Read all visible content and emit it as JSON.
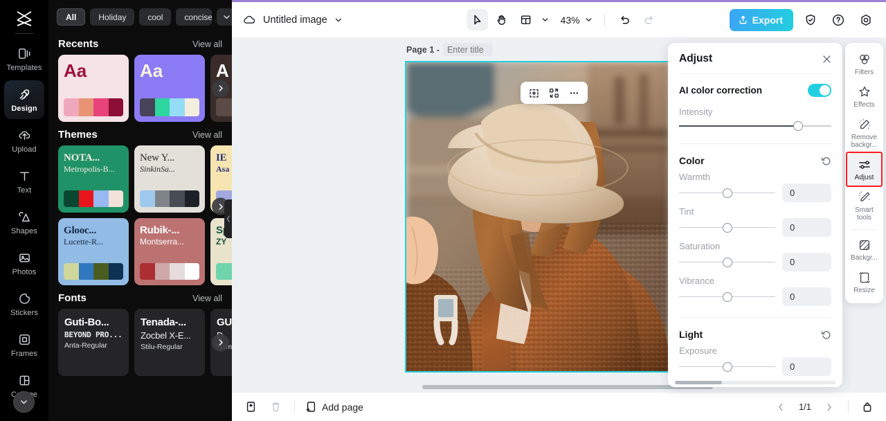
{
  "app": {
    "brand_icon": "capcut-logo-icon",
    "accent_top": "#9b7fd4"
  },
  "rail": {
    "items": [
      {
        "label": "Templates",
        "icon": "templates-icon",
        "active": false
      },
      {
        "label": "Design",
        "icon": "design-brush-icon",
        "active": true
      },
      {
        "label": "Upload",
        "icon": "upload-cloud-icon",
        "active": false
      },
      {
        "label": "Text",
        "icon": "text-t-icon",
        "active": false
      },
      {
        "label": "Shapes",
        "icon": "shapes-icon",
        "active": false
      },
      {
        "label": "Photos",
        "icon": "photos-image-icon",
        "active": false
      },
      {
        "label": "Stickers",
        "icon": "stickers-icon",
        "active": false
      },
      {
        "label": "Frames",
        "icon": "frames-icon",
        "active": false
      },
      {
        "label": "Collage",
        "icon": "collage-icon",
        "active": false
      }
    ],
    "collapse_icon": "chevron-down-icon"
  },
  "panel": {
    "chips": [
      {
        "label": "All",
        "selected": true
      },
      {
        "label": "Holiday",
        "selected": false
      },
      {
        "label": "cool",
        "selected": false
      },
      {
        "label": "concise",
        "selected": false
      }
    ],
    "chips_more_icon": "chevron-down-icon",
    "sections": [
      {
        "title": "Recents",
        "view_all": "View all"
      },
      {
        "title": "Themes",
        "view_all": "View all"
      },
      {
        "title": "Fonts",
        "view_all": "View all"
      }
    ],
    "recents": [
      {
        "sample": "Aa",
        "bg": "#f6e3e6",
        "fg": "#9e123c",
        "swatches": [
          "#f0a8bd",
          "#e79374",
          "#e8437b",
          "#8c0e35"
        ]
      },
      {
        "sample": "Aa",
        "bg": "#8b7bf5",
        "fg": "#f6f2dd",
        "swatches": [
          "#474359",
          "#2ed6a0",
          "#95dcf7",
          "#f3eedd"
        ]
      },
      {
        "sample": "A",
        "bg": "#3a2c2a",
        "fg": "#ffffff",
        "swatches": [
          "#5b4a46",
          "#3a2c2a",
          "#5b4a46",
          "#3a2c2a"
        ]
      }
    ],
    "themes": [
      {
        "line1": "NOTA...",
        "line2": "Metropolis-B...",
        "bg": "#1f9367",
        "fg": "#f7ece3",
        "swatches": [
          "#0a4733",
          "#e8161c",
          "#97b8f0",
          "#f2e2d9"
        ]
      },
      {
        "line1": "New Y...",
        "line2": "SinkinSa...",
        "bg": "#e3e0da",
        "fg": "#2a2a2c",
        "swatches": [
          "#9fc8ed",
          "#7f8489",
          "#474d54",
          "#1d2127"
        ]
      },
      {
        "line1": "IE",
        "line2": "Asa",
        "bg": "#f6e5b0",
        "fg": "#27307e",
        "swatches": [
          "#a3a9e0",
          "#a3a9e0",
          "#a3a9e0",
          "#a3a9e0"
        ]
      },
      {
        "line1": "Glooc...",
        "line2": "Lucette-R...",
        "bg": "#92bbe6",
        "fg": "#152a45",
        "swatches": [
          "#cfd79a",
          "#2f78c0",
          "#4b5c21",
          "#0d3253"
        ]
      },
      {
        "line1": "Rubik-...",
        "line2": "Montserra...",
        "bg": "#bd7272",
        "fg": "#ffffff",
        "swatches": [
          "#ab2f33",
          "#cfa9a9",
          "#e6dcdb",
          "#ffffff"
        ]
      },
      {
        "line1": "Sp",
        "line2": "ZY",
        "bg": "#e8e3cb",
        "fg": "#13533f",
        "swatches": [
          "#6fd4ab",
          "#6fd4ab",
          "#6fd4ab",
          "#6fd4ab"
        ]
      }
    ],
    "fonts": [
      {
        "l1": "Guti-Bo...",
        "l2": "BEYOND PRO...",
        "l3": "Anta-Regular"
      },
      {
        "l1": "Tenada-...",
        "l2": "Zocbel X-E...",
        "l3": "Stilu-Regular"
      },
      {
        "l1": "GU",
        "l2": "D",
        "l3": "Ham"
      }
    ],
    "next_arrow_icon": "chevron-right-icon",
    "collapse_handle_icon": "chevron-left-icon"
  },
  "topbar": {
    "cloud_icon": "cloud-saved-icon",
    "doc_title": "Untitled image",
    "doc_title_chevron": "chevron-down-icon",
    "tools": [
      {
        "name": "select-tool",
        "icon": "cursor-arrow-icon",
        "active": true
      },
      {
        "name": "hand-tool",
        "icon": "hand-icon",
        "active": false
      },
      {
        "name": "layout-tool",
        "icon": "layout-panel-icon",
        "active": false
      }
    ],
    "layout_chevron": "chevron-down-icon",
    "zoom_level": "43%",
    "zoom_chevron": "chevron-down-icon",
    "undo_icon": "undo-arrow-icon",
    "redo_icon": "redo-arrow-icon",
    "export_label": "Export",
    "export_icon": "upload-share-icon",
    "shield_icon": "shield-check-icon",
    "help_icon": "question-circle-icon",
    "settings_icon": "gear-icon"
  },
  "canvas": {
    "page_label": "Page 1 -",
    "title_placeholder": "Enter title",
    "title_value": "",
    "float_tools": [
      {
        "name": "crop-icon"
      },
      {
        "name": "replace-image-icon"
      },
      {
        "name": "more-options-icon"
      }
    ],
    "selection_color": "#22cfe0",
    "image_alt": "Woman in cream wide-brim hat and brown teddy coat, golden-hour portrait"
  },
  "adjust": {
    "title": "Adjust",
    "close_icon": "close-x-icon",
    "ai_color_correction": {
      "label": "AI color correction",
      "enabled": true
    },
    "intensity": {
      "label": "Intensity",
      "percent": 78
    },
    "sections": [
      {
        "title": "Color",
        "reset_icon": "reset-circular-icon",
        "controls": [
          {
            "label": "Warmth",
            "value": "0",
            "percent": 50
          },
          {
            "label": "Tint",
            "value": "0",
            "percent": 50
          },
          {
            "label": "Saturation",
            "value": "0",
            "percent": 50
          },
          {
            "label": "Vibrance",
            "value": "0",
            "percent": 50
          }
        ]
      },
      {
        "title": "Light",
        "reset_icon": "reset-circular-icon",
        "controls": [
          {
            "label": "Exposure",
            "value": "0",
            "percent": 50
          }
        ]
      }
    ]
  },
  "right_rail": {
    "items": [
      {
        "label": "Filters",
        "icon": "filters-circles-icon",
        "selected": false,
        "highlighted": false
      },
      {
        "label": "Effects",
        "icon": "effects-sparkle-icon",
        "selected": false,
        "highlighted": false
      },
      {
        "label": "Remove backgr...",
        "icon": "remove-background-icon",
        "selected": false,
        "highlighted": false
      },
      {
        "label": "Adjust",
        "icon": "adjust-sliders-icon",
        "selected": true,
        "highlighted": true
      },
      {
        "label": "Smart tools",
        "icon": "smart-tools-wand-icon",
        "selected": false,
        "highlighted": false
      },
      {
        "label": "Backgr...",
        "icon": "background-icon",
        "selected": false,
        "highlighted": false
      },
      {
        "label": "Resize",
        "icon": "resize-icon",
        "selected": false,
        "highlighted": false
      }
    ],
    "highlight_color": "#ff1a1a"
  },
  "bottombar": {
    "duplicate_icon": "duplicate-page-icon",
    "delete_icon": "trash-icon",
    "add_page_label": "Add page",
    "add_page_icon": "add-page-icon",
    "prev_icon": "chevron-left-icon",
    "page_indicator": "1/1",
    "next_icon": "chevron-right-icon",
    "expand_icon": "expand-panel-icon"
  }
}
